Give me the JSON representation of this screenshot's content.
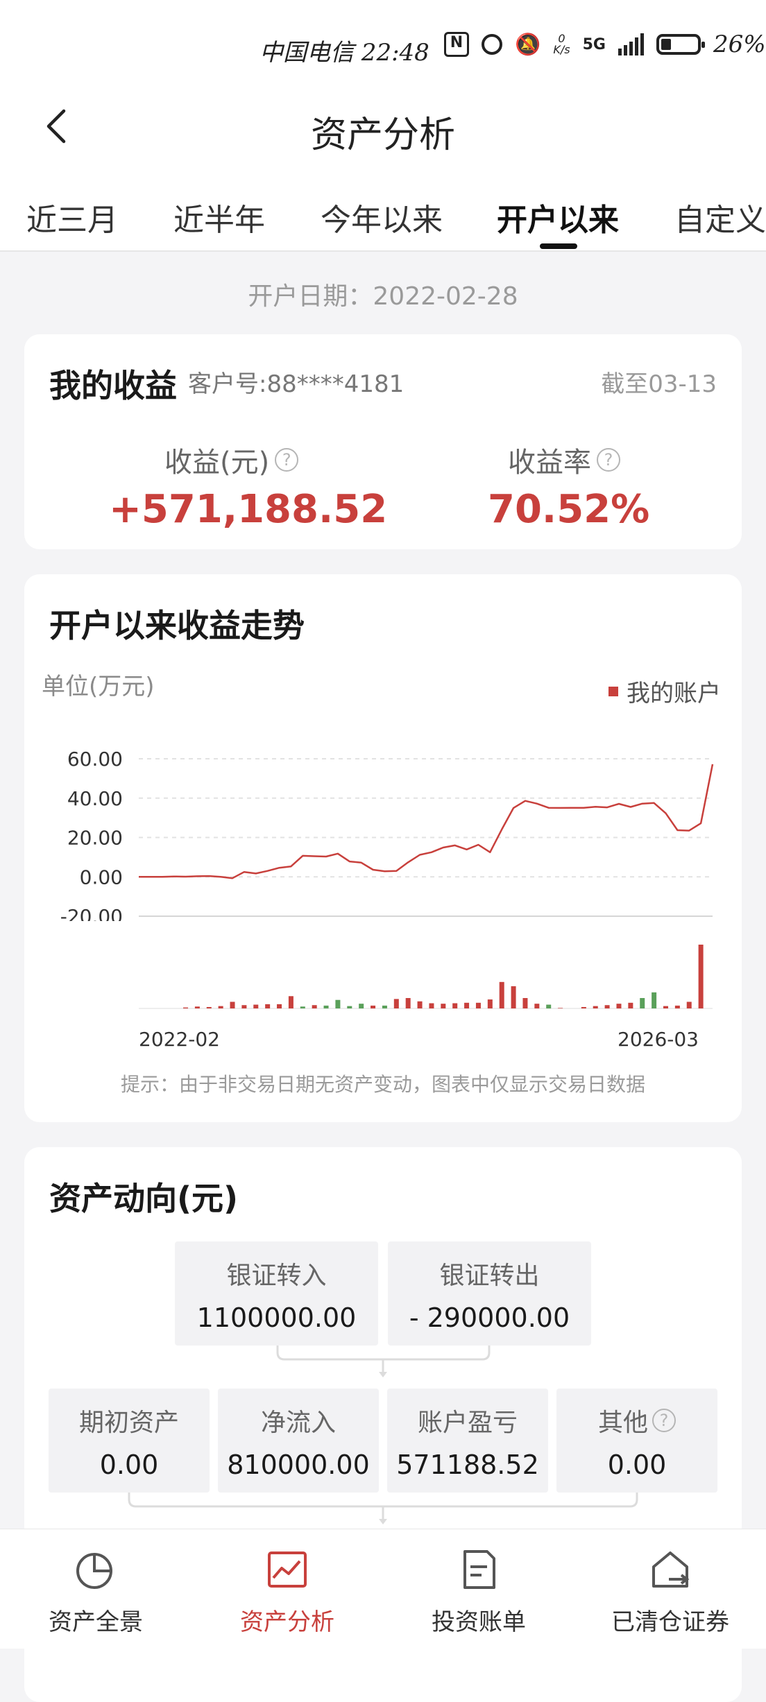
{
  "status_bar": {
    "carrier_time": "中国电信 22:48",
    "net_speed_top": "0",
    "net_speed_unit": "K/s",
    "network": "5G",
    "battery": "26%"
  },
  "header": {
    "title": "资产分析"
  },
  "tabs": [
    {
      "label": "近三月",
      "active": false
    },
    {
      "label": "近半年",
      "active": false
    },
    {
      "label": "今年以来",
      "active": false
    },
    {
      "label": "开户以来",
      "active": true
    },
    {
      "label": "自定义",
      "active": false
    }
  ],
  "open_date": "开户日期：2022-02-28",
  "earnings": {
    "title": "我的收益",
    "customer_no": "客户号:88****4181",
    "as_of": "截至03-13",
    "profit_label": "收益(元)",
    "profit_value": "+571,188.52",
    "rate_label": "收益率",
    "rate_value": "70.52%"
  },
  "trend": {
    "title": "开户以来收益走势",
    "unit_label": "单位(万元)",
    "legend_label": "我的账户",
    "hint": "提示：由于非交易日期无资产变动，图表中仅显示交易日数据"
  },
  "colors": {
    "accent": "#c8403c",
    "gain": "#c8403c",
    "loss": "#5aa05a"
  },
  "chart_data": {
    "type": "line",
    "title": "开户以来收益走势",
    "ylabel": "单位(万元)",
    "ylim": [
      -20,
      60
    ],
    "yticks": [
      "60.00",
      "40.00",
      "20.00",
      "0.00",
      "-20.00"
    ],
    "x_tick_labels": [
      "2022-02",
      "2026-03"
    ],
    "grid": true,
    "legend": "top-right",
    "series": [
      {
        "name": "我的账户",
        "values": [
          0,
          0,
          0,
          0.2,
          0.1,
          0.3,
          0.4,
          0,
          -0.7,
          2.5,
          1.7,
          3,
          4.6,
          5.3,
          10.7,
          10.5,
          10.3,
          11.8,
          7.8,
          7.2,
          3.6,
          2.8,
          3,
          7.4,
          11.2,
          12.5,
          14.9,
          16,
          13.9,
          16.3,
          12.5,
          24.1,
          35,
          38.6,
          37.2,
          35.1,
          35,
          35.1,
          35.1,
          35.6,
          35.3,
          37.1,
          35.5,
          37.2,
          37.5,
          32.3,
          23.7,
          23.5,
          27.2,
          57.2
        ]
      }
    ],
    "volume_bars": [
      0,
      0,
      0,
      0,
      0.2,
      0.4,
      0.3,
      0.5,
      1.4,
      0.7,
      0.8,
      0.9,
      0.9,
      2.6,
      -0.4,
      0.7,
      -0.6,
      -1.8,
      -0.5,
      -1,
      0.6,
      -0.6,
      2,
      2.2,
      1.5,
      1.1,
      1,
      1.1,
      1.2,
      1.2,
      1.9,
      5.6,
      4.7,
      2.2,
      1,
      -0.8,
      0.1,
      0,
      0.3,
      0.5,
      0.7,
      1,
      1.2,
      -2.2,
      -3.4,
      0.5,
      0.6,
      1.4,
      13.5,
      0
    ]
  },
  "asset_flow": {
    "title": "资产动向(元)",
    "bank_in_label": "银证转入",
    "bank_in_value": "1100000.00",
    "bank_out_label": "银证转出",
    "bank_out_value": "- 290000.00",
    "opening_label": "期初资产",
    "opening_value": "0.00",
    "net_inflow_label": "净流入",
    "net_inflow_value": "810000.00",
    "pnl_label": "账户盈亏",
    "pnl_value": "571188.52",
    "other_label": "其他",
    "other_value": "0.00"
  },
  "bottom_nav": [
    {
      "label": "资产全景",
      "icon": "pie-chart-icon",
      "active": false
    },
    {
      "label": "资产分析",
      "icon": "trend-chart-icon",
      "active": true
    },
    {
      "label": "投资账单",
      "icon": "bill-icon",
      "active": false
    },
    {
      "label": "已清仓证券",
      "icon": "cleared-stock-icon",
      "active": false
    }
  ]
}
